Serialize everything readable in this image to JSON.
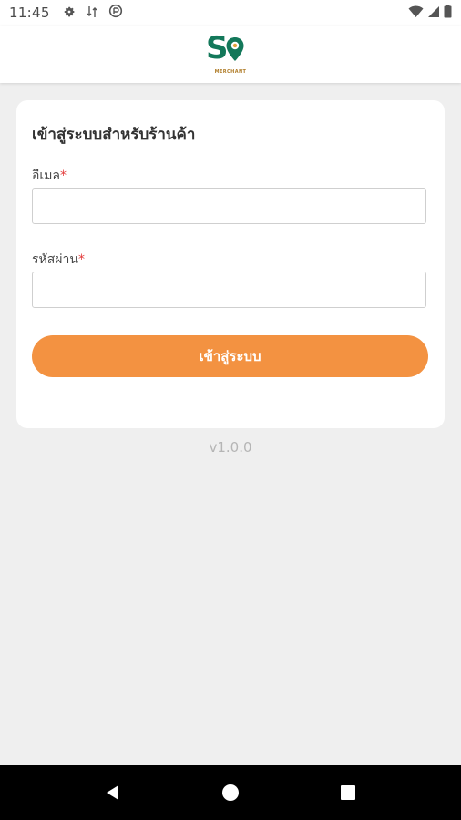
{
  "status_bar": {
    "time": "11:45",
    "icons_left": [
      "settings-icon",
      "data-transfer-icon",
      "sync-icon"
    ],
    "icons_right": [
      "wifi-icon",
      "cellular-signal-icon",
      "battery-icon"
    ]
  },
  "header": {
    "logo_text": "S",
    "logo_sub": "MERCHANT"
  },
  "login_card": {
    "title": "เข้าสู่ระบบสำหรับร้านค้า",
    "email_label": "อีเมล",
    "password_label": "รหัสผ่าน",
    "required_mark": "*",
    "email_value": "",
    "password_value": "",
    "submit_label": "เข้าสู่ระบบ"
  },
  "version": "v1.0.0",
  "nav_bar": {
    "buttons": [
      "back-icon",
      "home-icon",
      "recents-icon"
    ]
  },
  "colors": {
    "accent": "#f39241",
    "brand_green": "#13785a",
    "background": "#efefef",
    "required": "#e33b3b"
  }
}
